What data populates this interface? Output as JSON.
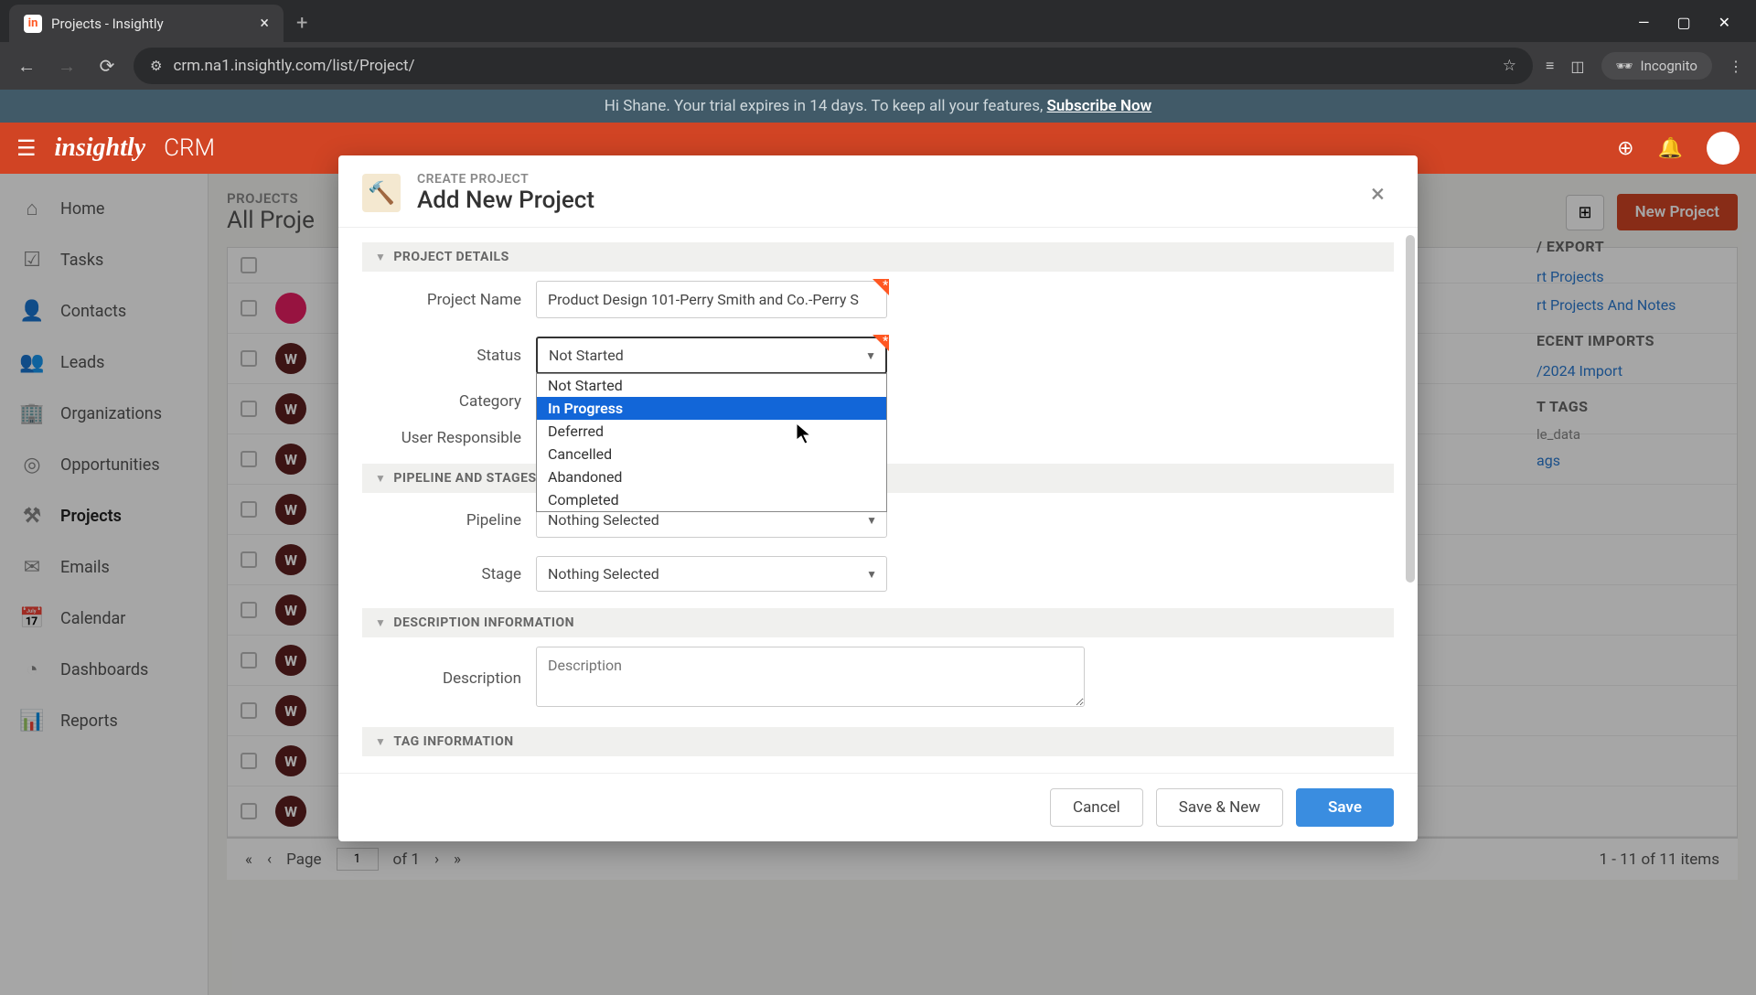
{
  "browser": {
    "tab_title": "Projects - Insightly",
    "url": "crm.na1.insightly.com/list/Project/",
    "incognito_label": "Incognito"
  },
  "trial_banner": {
    "greeting": "Hi Shane. Your trial expires in 14 days. To keep all your features, ",
    "cta": "Subscribe Now"
  },
  "header": {
    "logo": "insightly",
    "product": "CRM"
  },
  "sidebar": {
    "items": [
      {
        "label": "Home",
        "icon": "⌂"
      },
      {
        "label": "Tasks",
        "icon": "☑"
      },
      {
        "label": "Contacts",
        "icon": "👤"
      },
      {
        "label": "Leads",
        "icon": "👥"
      },
      {
        "label": "Organizations",
        "icon": "🏢"
      },
      {
        "label": "Opportunities",
        "icon": "◎"
      },
      {
        "label": "Projects",
        "icon": "⚒"
      },
      {
        "label": "Emails",
        "icon": "✉"
      },
      {
        "label": "Calendar",
        "icon": "📅"
      },
      {
        "label": "Dashboards",
        "icon": "◔"
      },
      {
        "label": "Reports",
        "icon": "📊"
      }
    ]
  },
  "content": {
    "list_subtitle": "PROJECTS",
    "list_title": "All Proje",
    "new_project_btn": "New Project",
    "right_panel": {
      "export_heading": "/ EXPORT",
      "export_link1": "rt Projects",
      "export_link2": "rt Projects And Notes",
      "imports_heading": "ECENT IMPORTS",
      "import_date": "/2024 Import",
      "tags_heading": "T TAGS",
      "tag1": "le_data",
      "tag2": "ags"
    },
    "pagination": {
      "page_label": "Page",
      "page_value": "1",
      "of_label": "of 1",
      "count": "1 - 11 of 11 items"
    }
  },
  "modal": {
    "eyebrow": "CREATE PROJECT",
    "title": "Add New Project",
    "sections": {
      "details": "PROJECT DETAILS",
      "pipeline": "PIPELINE AND STAGES",
      "description": "DESCRIPTION INFORMATION",
      "tags": "TAG INFORMATION"
    },
    "labels": {
      "project_name": "Project Name",
      "status": "Status",
      "category": "Category",
      "user_responsible": "User Responsible",
      "pipeline": "Pipeline",
      "stage": "Stage",
      "description": "Description"
    },
    "values": {
      "project_name": "Product Design 101-Perry Smith and Co.-Perry S",
      "status": "Not Started",
      "pipeline": "Nothing Selected",
      "stage": "Nothing Selected",
      "description_placeholder": "Description"
    },
    "status_options": [
      "Not Started",
      "In Progress",
      "Deferred",
      "Cancelled",
      "Abandoned",
      "Completed"
    ],
    "buttons": {
      "cancel": "Cancel",
      "save_new": "Save & New",
      "save": "Save"
    }
  }
}
